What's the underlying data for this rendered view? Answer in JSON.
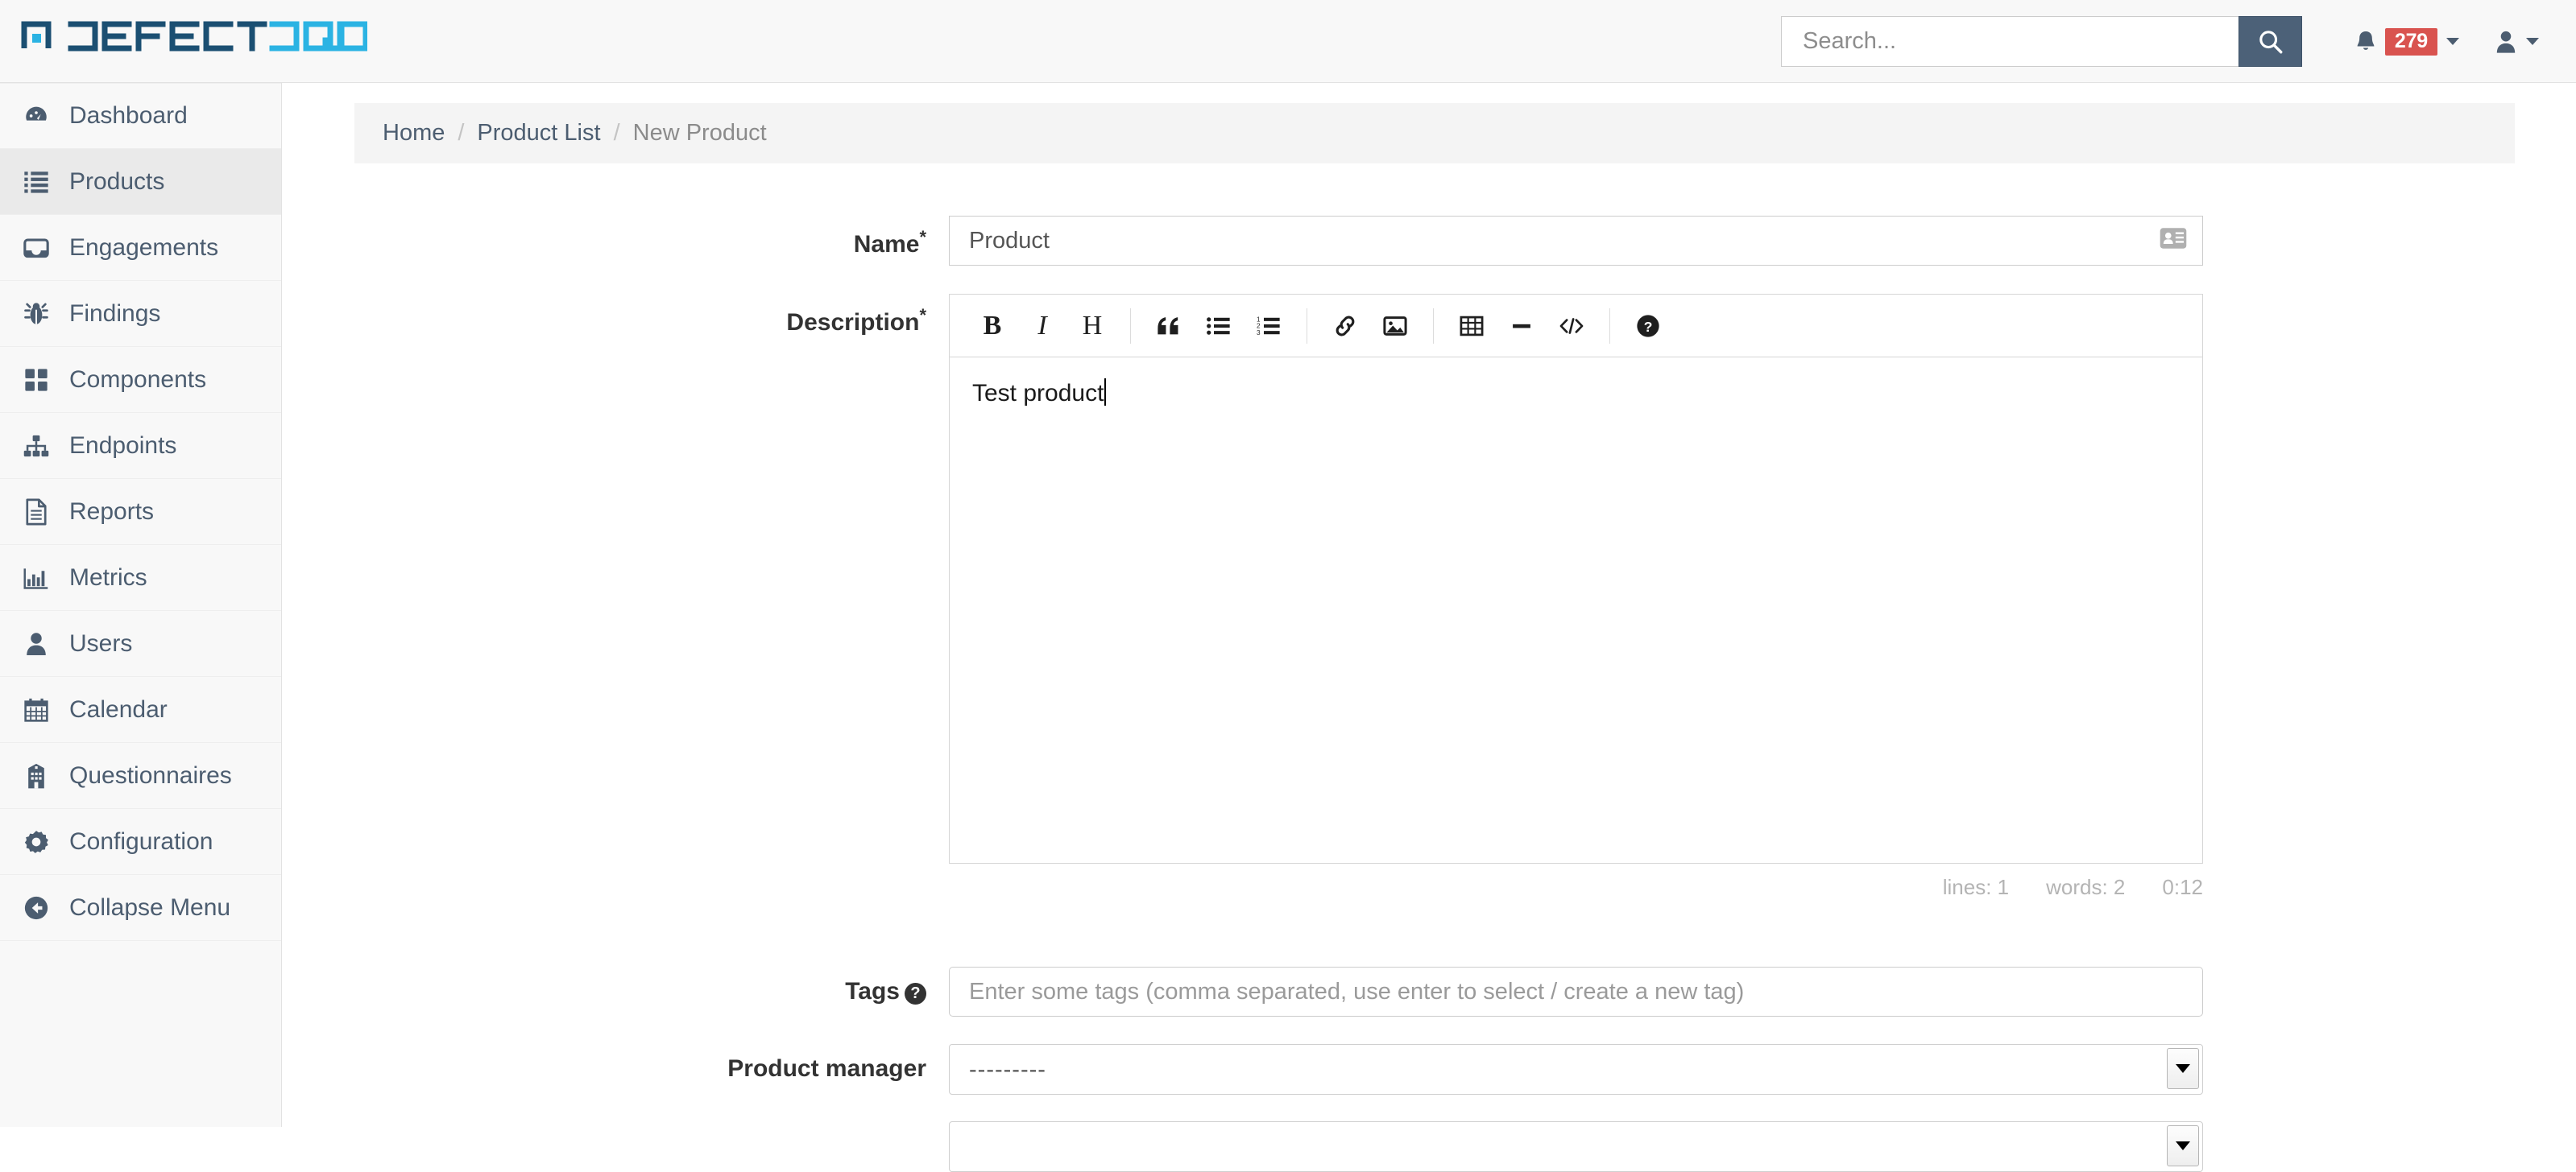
{
  "brand": {
    "text_defect": "DEFECT",
    "text_dojo": "DOJO",
    "dark_color": "#1b4f72",
    "light_color": "#2bb3e3"
  },
  "navbar": {
    "search_placeholder": "Search...",
    "search_value": "",
    "search_icon": "search-icon",
    "notification_icon": "bell-icon",
    "notification_count": "279",
    "notification_badge_color": "#d9534f",
    "user_icon": "user-icon",
    "search_button_color": "#4c6178"
  },
  "sidebar": {
    "items": [
      {
        "label": "Dashboard",
        "icon": "dashboard-icon",
        "active": false
      },
      {
        "label": "Products",
        "icon": "list-icon",
        "active": true
      },
      {
        "label": "Engagements",
        "icon": "inbox-icon",
        "active": false
      },
      {
        "label": "Findings",
        "icon": "bug-icon",
        "active": false
      },
      {
        "label": "Components",
        "icon": "grid-icon",
        "active": false
      },
      {
        "label": "Endpoints",
        "icon": "sitemap-icon",
        "active": false
      },
      {
        "label": "Reports",
        "icon": "document-icon",
        "active": false
      },
      {
        "label": "Metrics",
        "icon": "bar-chart-icon",
        "active": false
      },
      {
        "label": "Users",
        "icon": "user-icon",
        "active": false
      },
      {
        "label": "Calendar",
        "icon": "calendar-icon",
        "active": false
      },
      {
        "label": "Questionnaires",
        "icon": "building-icon",
        "active": false
      },
      {
        "label": "Configuration",
        "icon": "gear-icon",
        "active": false
      },
      {
        "label": "Collapse Menu",
        "icon": "arrow-circle-left-icon",
        "active": false
      }
    ]
  },
  "breadcrumb": {
    "home": "Home",
    "product_list": "Product List",
    "current": "New Product",
    "separator": "/"
  },
  "form": {
    "name": {
      "label": "Name",
      "required_marker": "*",
      "value": "Product",
      "placeholder": "",
      "trailing_icon": "address-card-icon"
    },
    "description": {
      "label": "Description",
      "required_marker": "*",
      "value": "Test product",
      "toolbar": [
        {
          "name": "bold-icon",
          "glyph": "B"
        },
        {
          "name": "italic-icon",
          "glyph": "I"
        },
        {
          "name": "heading-icon",
          "glyph": "H"
        },
        {
          "name": "quote-icon",
          "glyph": "“"
        },
        {
          "name": "unordered-list-icon",
          "glyph": ""
        },
        {
          "name": "ordered-list-icon",
          "glyph": ""
        },
        {
          "name": "link-icon",
          "glyph": ""
        },
        {
          "name": "image-icon",
          "glyph": ""
        },
        {
          "name": "table-icon",
          "glyph": ""
        },
        {
          "name": "horizontal-rule-icon",
          "glyph": ""
        },
        {
          "name": "code-icon",
          "glyph": ""
        },
        {
          "name": "help-icon",
          "glyph": "?"
        }
      ],
      "status": {
        "lines": "lines: 1",
        "words": "words: 2",
        "time": "0:12"
      }
    },
    "tags": {
      "label": "Tags",
      "help_icon": "question-circle-icon",
      "placeholder": "Enter some tags (comma separated, use enter to select / create a new tag)",
      "value": ""
    },
    "product_manager": {
      "label": "Product manager",
      "selected": "---------",
      "options": [
        "---------"
      ]
    },
    "next_field": {
      "selected": "",
      "options": [
        ""
      ]
    }
  }
}
